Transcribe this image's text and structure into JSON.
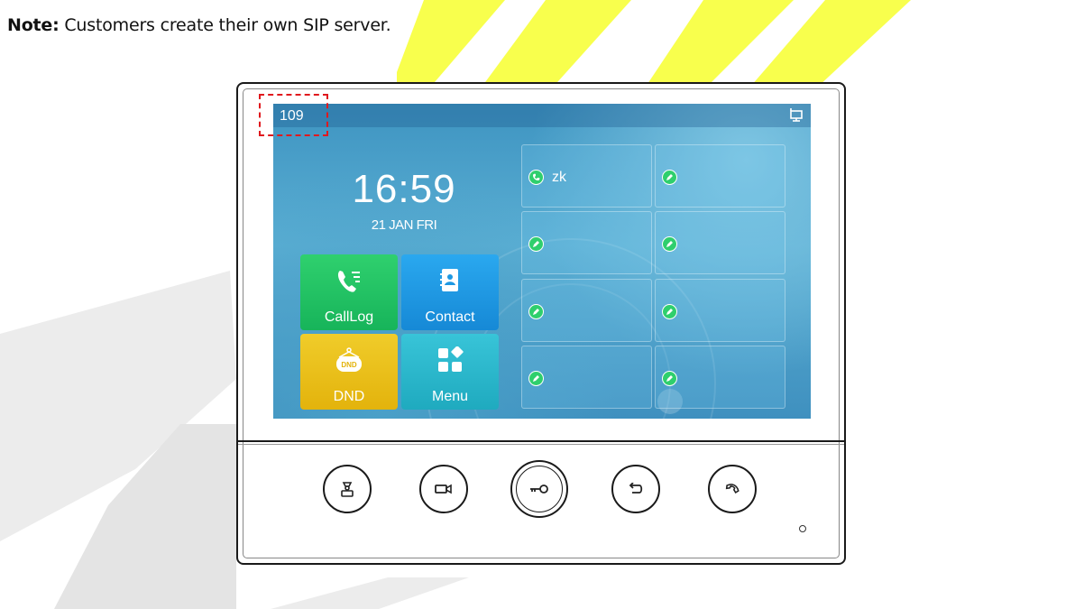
{
  "note": {
    "bold": "Note:",
    "text": " Customers create their own SIP server."
  },
  "status_bar": {
    "extension": "109",
    "network_icon": "network-icon"
  },
  "clock": {
    "time": "16:59",
    "date": "21 JAN FRI"
  },
  "tiles": [
    {
      "label": "CallLog",
      "icon": "calllog-icon",
      "color": "#1fbf62"
    },
    {
      "label": "Contact",
      "icon": "contact-book-icon",
      "color": "#1e98e2"
    },
    {
      "label": "DND",
      "icon": "dnd-icon",
      "color": "#e9be18"
    },
    {
      "label": "Menu",
      "icon": "menu-grid-icon",
      "color": "#2ab7cb"
    }
  ],
  "dss_keys": [
    {
      "label": "zk",
      "icon": "phone-icon"
    },
    {
      "label": "",
      "icon": "edit-icon"
    },
    {
      "label": "",
      "icon": "edit-icon"
    },
    {
      "label": "",
      "icon": "edit-icon"
    },
    {
      "label": "",
      "icon": "edit-icon"
    },
    {
      "label": "",
      "icon": "edit-icon"
    },
    {
      "label": "",
      "icon": "edit-icon"
    },
    {
      "label": "",
      "icon": "edit-icon"
    }
  ],
  "hardware_buttons": [
    "monitor-icon",
    "video-icon",
    "unlock-key-icon",
    "return-icon",
    "hangup-icon"
  ],
  "colors": {
    "highlight": "#e0191e",
    "key_icon": "#2fcf6d",
    "watermark": "#f4ff00"
  }
}
